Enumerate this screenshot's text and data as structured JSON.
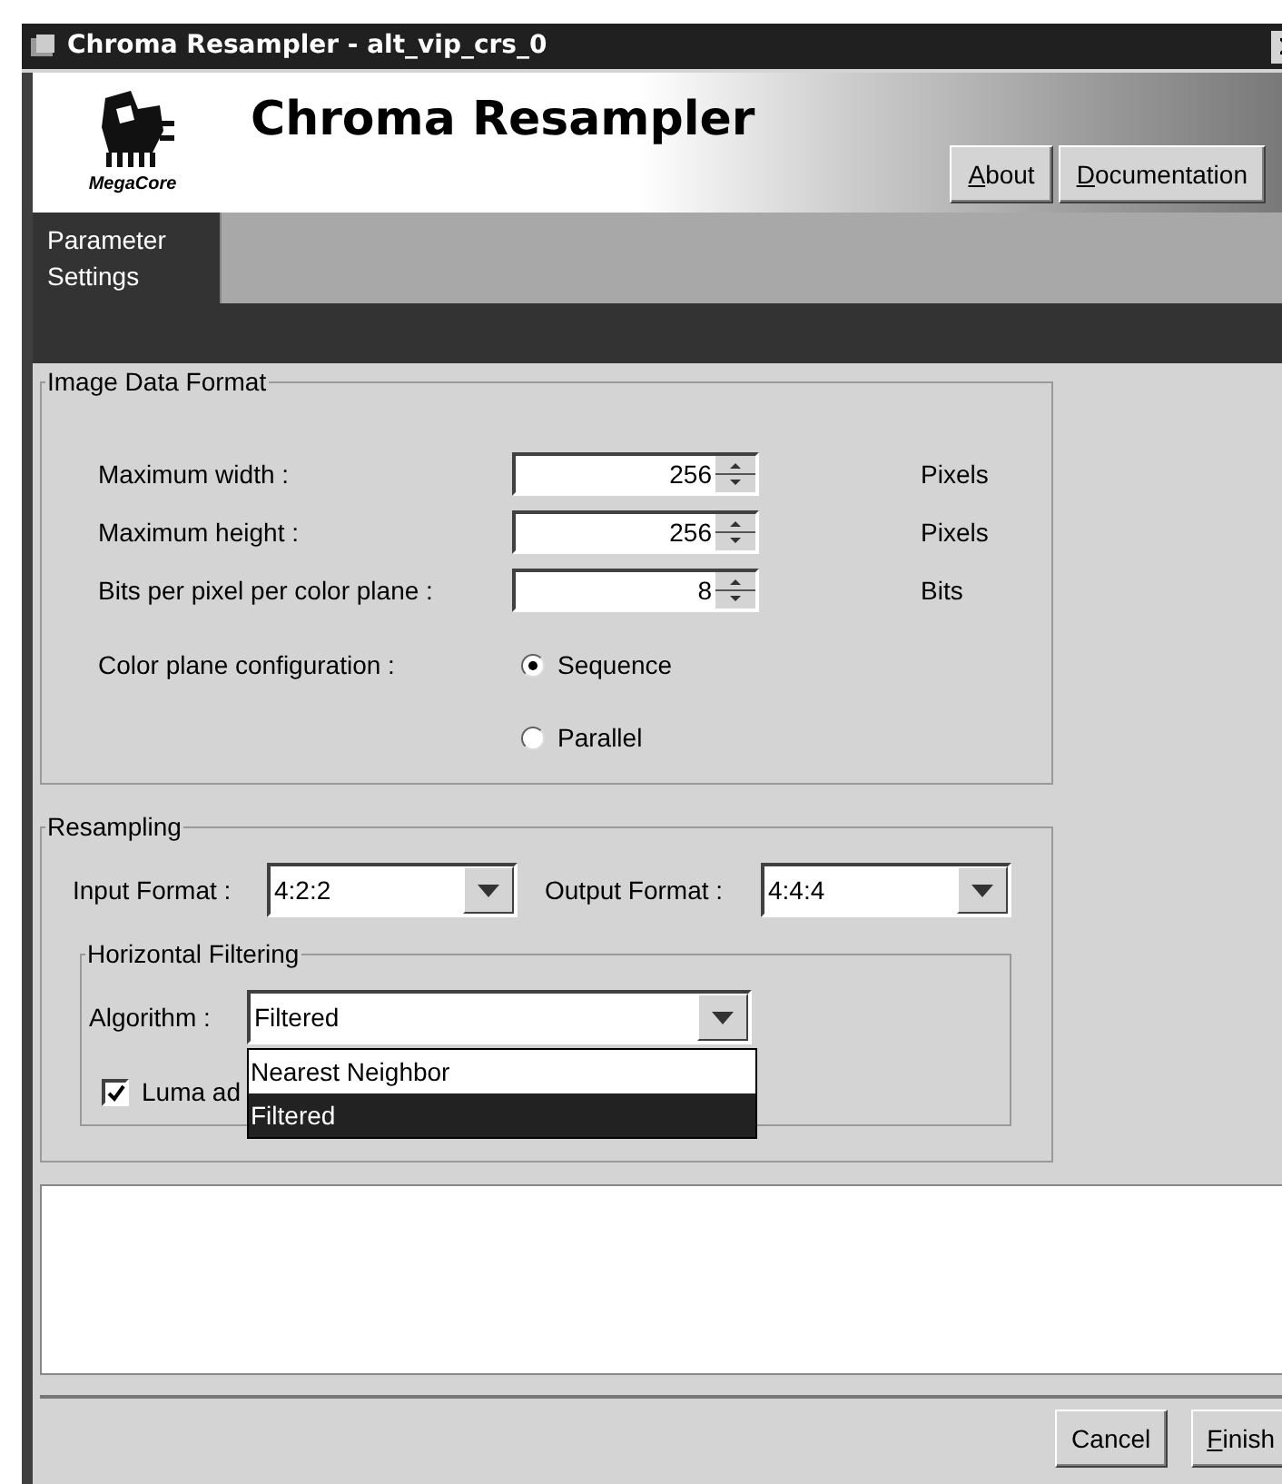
{
  "window": {
    "title": "Chroma Resampler - alt_vip_crs_0"
  },
  "header": {
    "logo_text": "MegaCore",
    "title": "Chroma Resampler",
    "buttons": [
      {
        "label": "About",
        "mnemonic": true
      },
      {
        "label": "Documentation",
        "mnemonic": true
      }
    ]
  },
  "tabs": [
    {
      "label": "Parameter Settings",
      "selected": true
    }
  ],
  "image_data_format": {
    "title": "Image Data Format",
    "fields": [
      {
        "label": "Maximum width :",
        "value": "256",
        "unit": "Pixels"
      },
      {
        "label": "Maximum height :",
        "value": "256",
        "unit": "Pixels"
      },
      {
        "label": "Bits per pixel per color plane :",
        "value": "8",
        "unit": "Bits"
      }
    ],
    "color_plane": {
      "label": "Color plane configuration :",
      "options": [
        {
          "label": "Sequence",
          "selected": true
        },
        {
          "label": "Parallel",
          "selected": false
        }
      ]
    }
  },
  "resampling": {
    "title": "Resampling",
    "input_format": {
      "label": "Input Format :",
      "value": "4:2:2"
    },
    "output_format": {
      "label": "Output Format :",
      "value": "4:4:4"
    },
    "horizontal_filtering": {
      "title": "Horizontal Filtering",
      "algorithm": {
        "label": "Algorithm :",
        "value": "Filtered",
        "expanded": true,
        "options": [
          {
            "label": "Nearest Neighbor",
            "selected": false
          },
          {
            "label": "Filtered",
            "selected": true
          }
        ]
      },
      "luma": {
        "label": "Luma ad",
        "checked": true
      }
    }
  },
  "buttons": [
    {
      "label": "Cancel",
      "mnemonic": false
    },
    {
      "label": "Finish",
      "mnemonic": true
    }
  ]
}
